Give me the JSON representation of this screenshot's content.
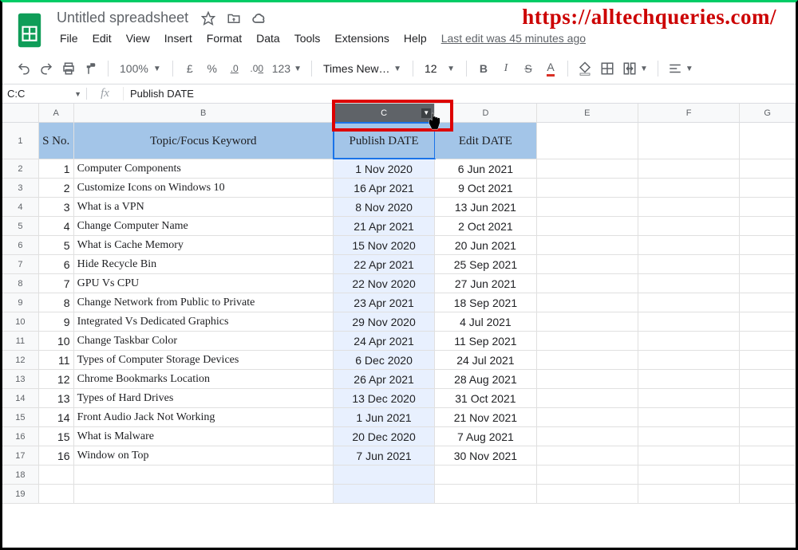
{
  "watermark": "https://alltechqueries.com/",
  "title": "Untitled spreadsheet",
  "menus": [
    "File",
    "Edit",
    "View",
    "Insert",
    "Format",
    "Data",
    "Tools",
    "Extensions",
    "Help"
  ],
  "edit_status": "Last edit was 45 minutes ago",
  "toolbar": {
    "zoom": "100%",
    "currency": "£",
    "percent": "%",
    "dec_dec": ".0",
    "inc_dec": ".00",
    "numfmt": "123",
    "font": "Times New…",
    "size": "12",
    "bold": "B",
    "italic": "I",
    "strike": "S",
    "textcolor": "A"
  },
  "namebox": "C:C",
  "fx": "fx",
  "formula": "Publish DATE",
  "columns": [
    "A",
    "B",
    "C",
    "D",
    "E",
    "F",
    "G"
  ],
  "headers": {
    "a": "S No.",
    "b": "Topic/Focus Keyword",
    "c": "Publish DATE",
    "d": "Edit DATE"
  },
  "rows": [
    {
      "n": "1",
      "a": "1",
      "b": "Computer Components",
      "c": "1 Nov 2020",
      "d": "6 Jun 2021"
    },
    {
      "n": "2",
      "a": "2",
      "b": "Customize Icons on Windows 10",
      "c": "16 Apr 2021",
      "d": "9 Oct 2021"
    },
    {
      "n": "3",
      "a": "3",
      "b": "What is a VPN",
      "c": "8 Nov 2020",
      "d": "13 Jun 2021"
    },
    {
      "n": "4",
      "a": "4",
      "b": "Change Computer Name",
      "c": "21 Apr 2021",
      "d": "2 Oct 2021"
    },
    {
      "n": "5",
      "a": "5",
      "b": "What is Cache Memory",
      "c": "15 Nov 2020",
      "d": "20 Jun 2021"
    },
    {
      "n": "6",
      "a": "6",
      "b": "Hide Recycle Bin",
      "c": "22 Apr 2021",
      "d": "25 Sep 2021"
    },
    {
      "n": "7",
      "a": "7",
      "b": "GPU Vs CPU",
      "c": "22 Nov 2020",
      "d": "27 Jun 2021"
    },
    {
      "n": "8",
      "a": "8",
      "b": "Change Network from Public to Private",
      "c": "23 Apr 2021",
      "d": "18 Sep 2021"
    },
    {
      "n": "9",
      "a": "9",
      "b": "Integrated Vs Dedicated Graphics",
      "c": "29 Nov 2020",
      "d": "4 Jul 2021"
    },
    {
      "n": "10",
      "a": "10",
      "b": "Change Taskbar Color",
      "c": "24 Apr 2021",
      "d": "11 Sep 2021"
    },
    {
      "n": "11",
      "a": "11",
      "b": "Types of Computer Storage Devices",
      "c": "6 Dec 2020",
      "d": "24 Jul 2021"
    },
    {
      "n": "12",
      "a": "12",
      "b": "Chrome Bookmarks Location",
      "c": "26 Apr 2021",
      "d": "28 Aug 2021"
    },
    {
      "n": "13",
      "a": "13",
      "b": "Types of Hard Drives",
      "c": "13 Dec 2020",
      "d": "31 Oct 2021"
    },
    {
      "n": "14",
      "a": "14",
      "b": "Front Audio Jack Not Working",
      "c": "1 Jun 2021",
      "d": "21 Nov 2021"
    },
    {
      "n": "15",
      "a": "15",
      "b": "What is Malware",
      "c": "20 Dec 2020",
      "d": "7 Aug 2021"
    },
    {
      "n": "16",
      "a": "16",
      "b": "Window on Top",
      "c": "7 Jun 2021",
      "d": "30 Nov 2021"
    }
  ]
}
